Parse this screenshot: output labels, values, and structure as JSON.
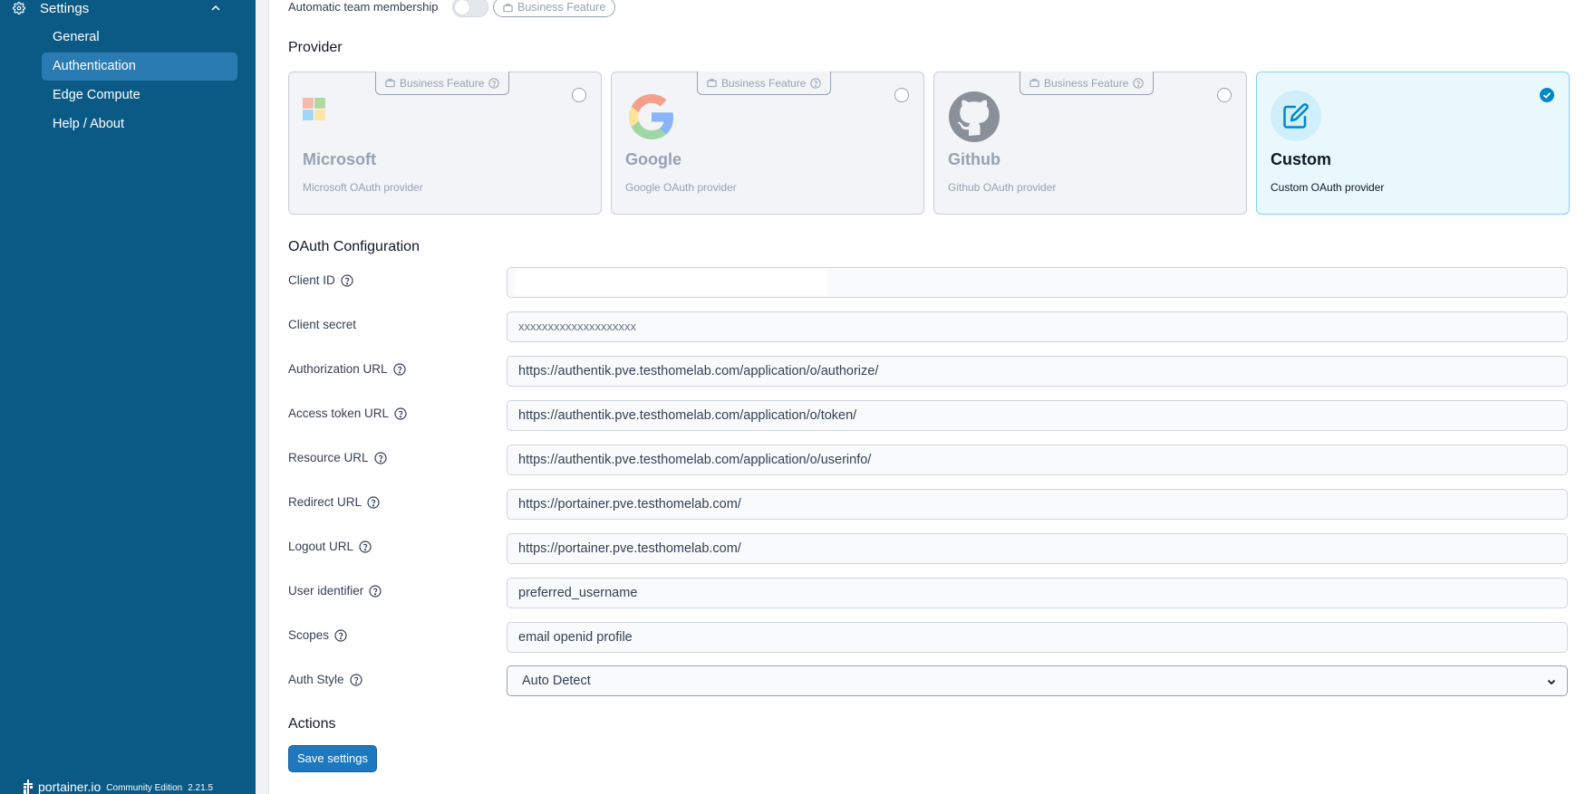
{
  "sidebar": {
    "section_title": "Settings",
    "items": [
      {
        "label": "General"
      },
      {
        "label": "Authentication"
      },
      {
        "label": "Edge Compute"
      },
      {
        "label": "Help / About"
      }
    ],
    "footer": {
      "brand": "portainer.io",
      "edition": "Community Edition",
      "version": "2.21.5"
    },
    "colors": {
      "background": "#0b5a86",
      "active_item": "#2a7bb1"
    }
  },
  "team_membership": {
    "label": "Automatic team membership",
    "toggle_on": false,
    "badge": "Business Feature"
  },
  "provider": {
    "title": "Provider",
    "cards": [
      {
        "name": "Microsoft",
        "description": "Microsoft OAuth provider",
        "badge": "Business Feature",
        "selected": false,
        "icon": "microsoft-logo"
      },
      {
        "name": "Google",
        "description": "Google OAuth provider",
        "badge": "Business Feature",
        "selected": false,
        "icon": "google-logo"
      },
      {
        "name": "Github",
        "description": "Github OAuth provider",
        "badge": "Business Feature",
        "selected": false,
        "icon": "github-logo"
      },
      {
        "name": "Custom",
        "description": "Custom OAuth provider",
        "badge": "",
        "selected": true,
        "icon": "edit-icon"
      }
    ]
  },
  "oauth": {
    "title": "OAuth Configuration",
    "fields": {
      "client_id": {
        "label": "Client ID",
        "value": ""
      },
      "client_secret": {
        "label": "Client secret",
        "placeholder": "xxxxxxxxxxxxxxxxxxxx"
      },
      "authorization_url": {
        "label": "Authorization URL",
        "value": "https://authentik.pve.testhomelab.com/application/o/authorize/"
      },
      "access_token_url": {
        "label": "Access token URL",
        "value": "https://authentik.pve.testhomelab.com/application/o/token/"
      },
      "resource_url": {
        "label": "Resource URL",
        "value": "https://authentik.pve.testhomelab.com/application/o/userinfo/"
      },
      "redirect_url": {
        "label": "Redirect URL",
        "value": "https://portainer.pve.testhomelab.com/"
      },
      "logout_url": {
        "label": "Logout URL",
        "value": "https://portainer.pve.testhomelab.com/"
      },
      "user_identifier": {
        "label": "User identifier",
        "value": "preferred_username"
      },
      "scopes": {
        "label": "Scopes",
        "value": "email openid profile"
      },
      "auth_style": {
        "label": "Auth Style",
        "value": "Auto Detect"
      }
    }
  },
  "actions": {
    "title": "Actions",
    "save_label": "Save settings"
  }
}
